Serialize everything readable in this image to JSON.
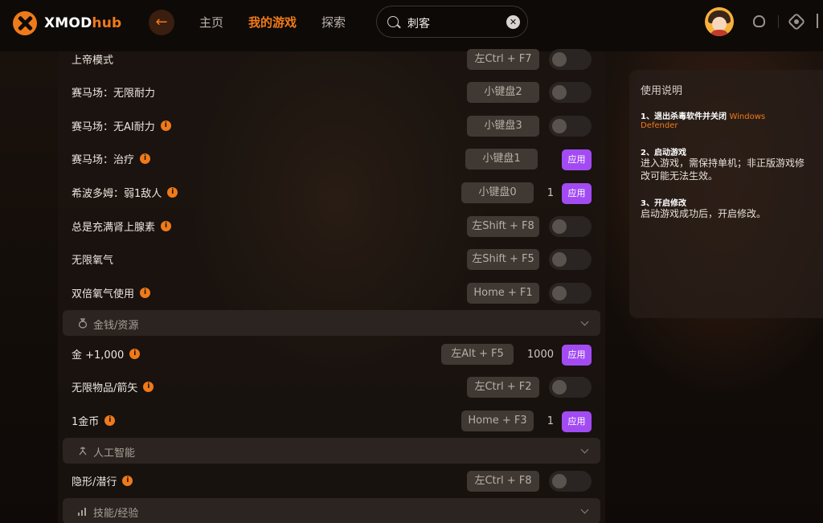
{
  "app": {
    "logo_text_a": "XMOD",
    "logo_text_b": "hub",
    "nav": [
      "主页",
      "我的游戏",
      "探索"
    ],
    "active_nav": "我的游戏",
    "search_value": "刺客",
    "accent_color": "#f07a1a",
    "apply_color": "#a24bf3"
  },
  "rows": [
    {
      "label": "上帝模式",
      "info": false,
      "hotkey": "左Ctrl + F7",
      "control": "toggle"
    },
    {
      "label": "赛马场：无限耐力",
      "info": false,
      "hotkey": "小键盘2",
      "control": "toggle"
    },
    {
      "label": "赛马场：无AI耐力",
      "info": true,
      "hotkey": "小键盘3",
      "control": "toggle"
    },
    {
      "label": "赛马场：治疗",
      "info": true,
      "hotkey": "小键盘1",
      "control": "apply",
      "apply_label": "应用"
    },
    {
      "label": "希波多姆：弱1敌人",
      "info": true,
      "hotkey": "小键盘0",
      "control": "apply",
      "value": "1",
      "apply_label": "应用"
    },
    {
      "label": "总是充满肾上腺素",
      "info": true,
      "hotkey": "左Shift + F8",
      "control": "toggle"
    },
    {
      "label": "无限氧气",
      "info": false,
      "hotkey": "左Shift + F5",
      "control": "toggle"
    },
    {
      "label": "双倍氧气使用",
      "info": true,
      "hotkey": "Home + F1",
      "control": "toggle"
    }
  ],
  "sections": [
    {
      "label": "金钱/资源",
      "icon": "money-bag-icon"
    },
    {
      "label": "人工智能",
      "icon": "ai-icon"
    },
    {
      "label": "技能/经验",
      "icon": "chart-icon"
    }
  ],
  "money_rows": [
    {
      "label": "金 +1,000",
      "info": true,
      "hotkey": "左Alt + F5",
      "control": "apply",
      "value": "1000",
      "apply_label": "应用"
    },
    {
      "label": "无限物品/箭矢",
      "info": true,
      "hotkey": "左Ctrl + F2",
      "control": "toggle"
    },
    {
      "label": "1金币",
      "info": true,
      "hotkey": "Home + F3",
      "control": "apply",
      "value": "1",
      "apply_label": "应用"
    }
  ],
  "ai_rows": [
    {
      "label": "隐形/潜行",
      "info": true,
      "hotkey": "左Ctrl + F8",
      "control": "toggle"
    }
  ],
  "instructions": {
    "title": "使用说明",
    "step1_title": "1、退出杀毒软件并关闭",
    "step1_highlight": "Windows Defender",
    "step2_title": "2、启动游戏",
    "step2_body": "进入游戏，需保持单机；非正版游戏修改可能无法生效。",
    "step3_title": "3、开启修改",
    "step3_body": "启动游戏成功后，开启修改。"
  },
  "info_glyph": "i"
}
